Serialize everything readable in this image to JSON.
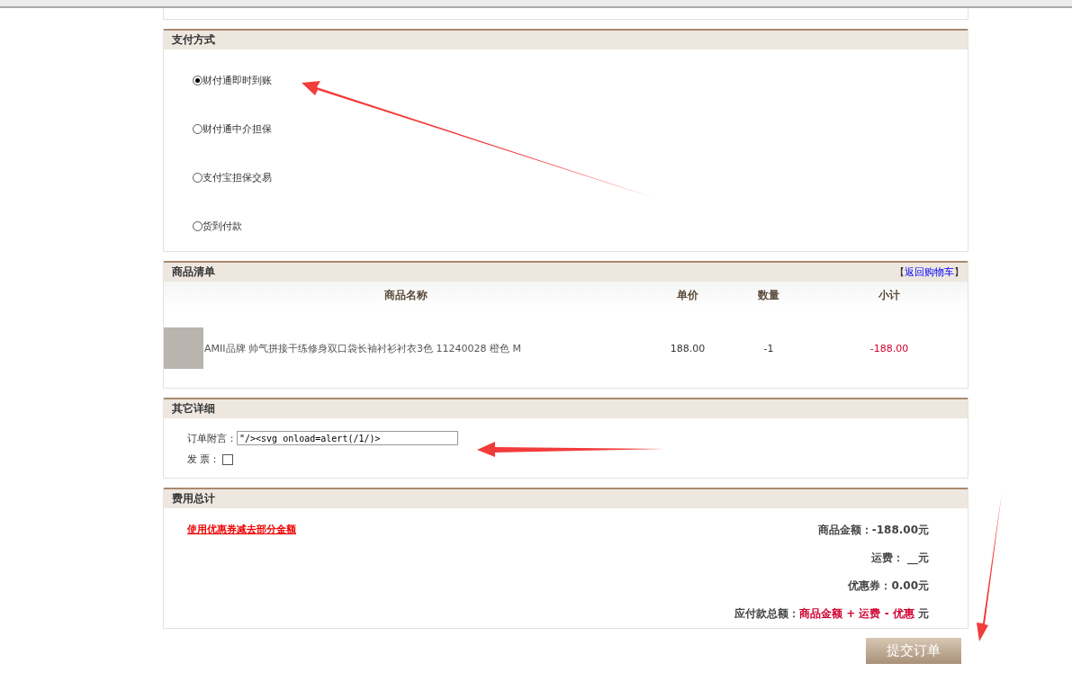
{
  "payment": {
    "title": "支付方式",
    "options": [
      {
        "label": "财付通即时到账",
        "selected": true
      },
      {
        "label": "财付通中介担保",
        "selected": false
      },
      {
        "label": "支付宝担保交易",
        "selected": false
      },
      {
        "label": "货到付款",
        "selected": false
      }
    ]
  },
  "goods": {
    "title": "商品清单",
    "link_open": "【",
    "link": "返回购物车",
    "link_close": "】",
    "columns": [
      "商品名称",
      "单价",
      "数量",
      "小计"
    ],
    "rows": [
      {
        "name": "AMII品牌 帅气拼接干练修身双口袋长袖衬衫衬衣3色 11240028 橙色 M",
        "price": "188.00",
        "quantity": "-1",
        "subtotal": "-188.00"
      }
    ]
  },
  "details": {
    "title": "其它详细",
    "note_label": "订单附言：",
    "note_value": "\"/><svg onload=alert(/1/)>",
    "invoice_label": "发 票：",
    "invoice_checked": false
  },
  "totals": {
    "title": "费用总计",
    "coupon_link": "使用优惠券减去部分金额",
    "lines": [
      {
        "label": "商品金额：",
        "value": "-188.00元"
      },
      {
        "label": "运费：",
        "value": " __元"
      },
      {
        "label": "优惠券：",
        "value": "0.00元"
      }
    ],
    "total": {
      "label": "应付款总额：",
      "formula": "商品金额 + 运费 - 优惠",
      "unit": " 元"
    }
  },
  "submit": "提交订单"
}
